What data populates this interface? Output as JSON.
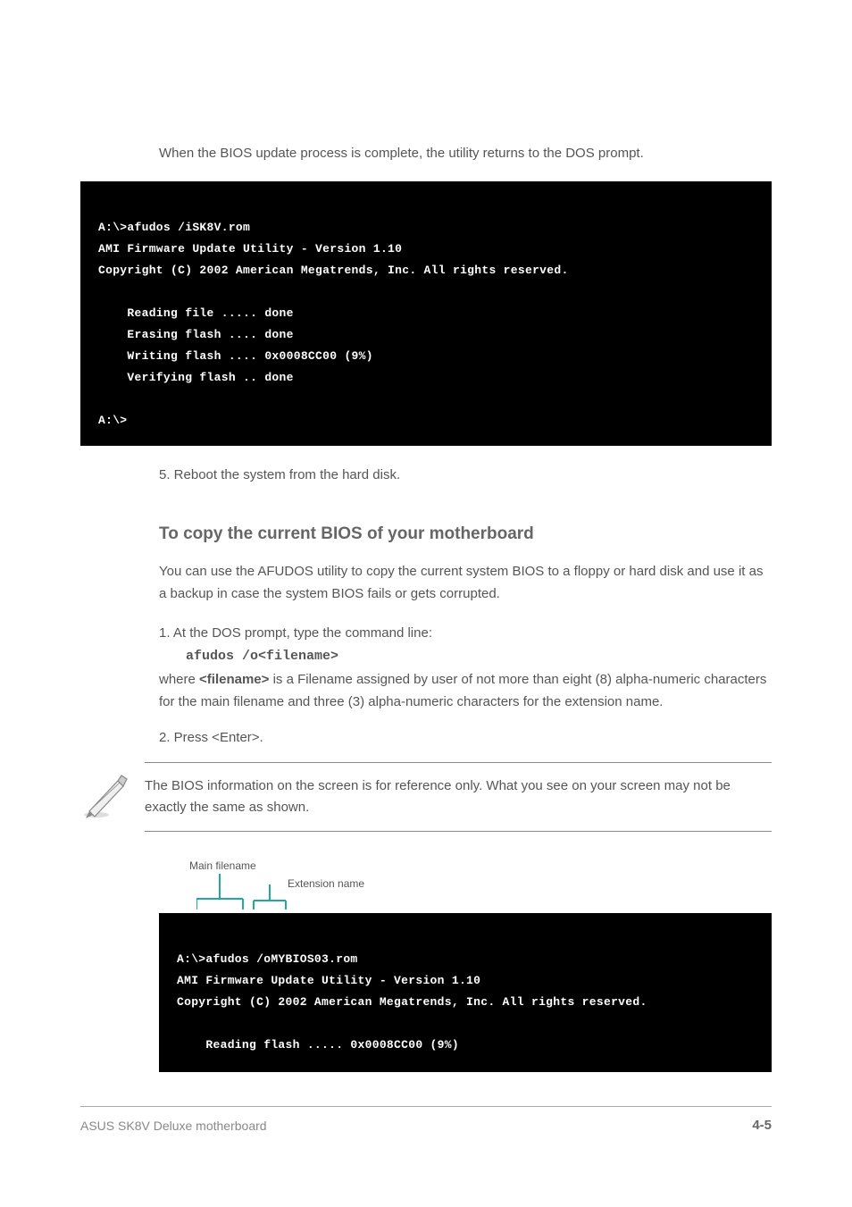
{
  "terminal1": {
    "line1": "A:\\>afudos /iSK8V.rom",
    "line2": "AMI Firmware Update Utility - Version 1.10",
    "line3": "Copyright (C) 2002 American Megatrends, Inc. All rights reserved.",
    "blank1": "",
    "line4": "    Reading file ..... done",
    "line5": "    Erasing flash .... done",
    "line6": "    Writing flash .... 0x0008CC00 (9%)",
    "line7": "    Verifying flash .. done",
    "blank2": "",
    "line8": "A:\\>"
  },
  "para1": "When the BIOS update process is complete, the utility returns to the DOS prompt.",
  "para2_prefix": "5.   Reboot the system from the hard disk.",
  "section_heading": "To copy the current BIOS of your motherboard",
  "intro": "You can use the AFUDOS utility to copy the current system BIOS to a floppy or hard disk and use it as a backup in case the system BIOS fails or gets corrupted.",
  "step1_prefix": "1.   At the DOS prompt, type the command line: ",
  "step1_cmd": "afudos /o",
  "step1_file": "<filename>",
  "step1_where": "where ",
  "step1_filename_ref": "<filename>",
  "step1_where_rest": " is a Filename assigned by user of not more than eight (8) alpha-numeric characters for the main filename and three (3) alpha-numeric characters for the extension name.",
  "step2": "2.   Press <Enter>.",
  "note": "The BIOS information on the screen is for reference only. What you see on your screen may not be exactly the same as shown.",
  "labels": {
    "filename": "Main filename",
    "ext": "Extension name"
  },
  "terminal2": {
    "line1": "A:\\>afudos /oMYBIOS03.rom",
    "line2": "AMI Firmware Update Utility - Version 1.10",
    "line3": "Copyright (C) 2002 American Megatrends, Inc. All rights reserved.",
    "blank1": "",
    "line4": "    Reading flash ..... 0x0008CC00 (9%)"
  },
  "footer": {
    "left": "ASUS SK8V Deluxe motherboard",
    "right": "4-5"
  }
}
